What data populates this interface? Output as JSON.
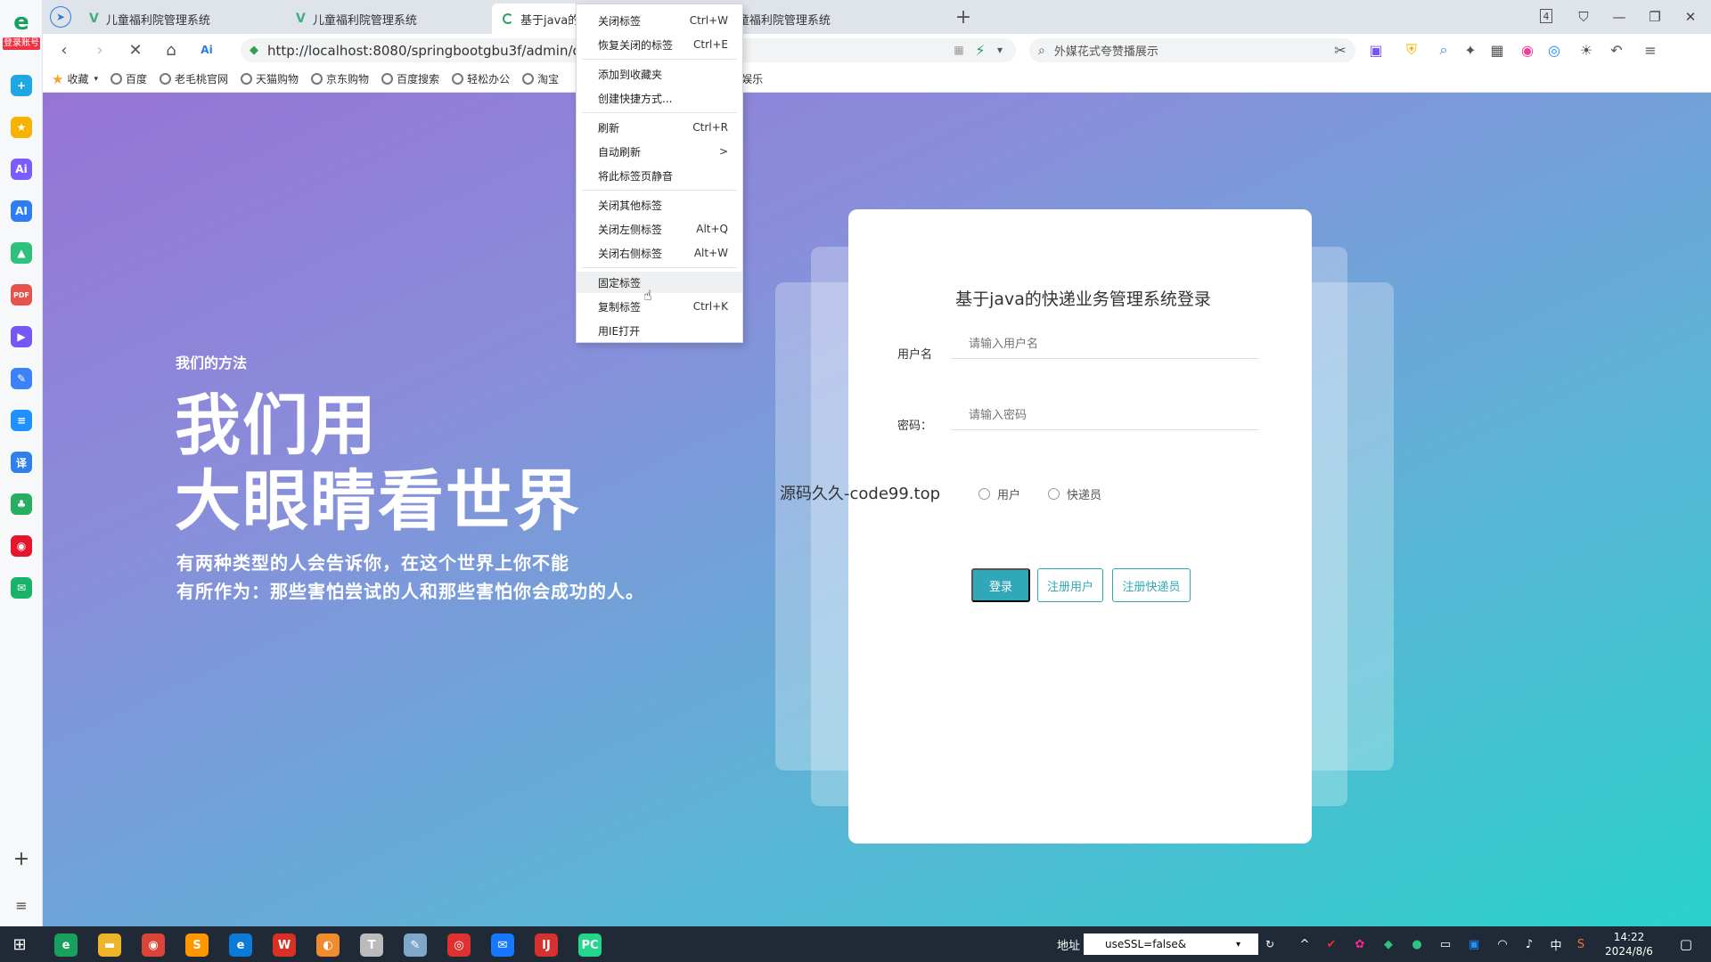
{
  "sidebar": {
    "logo_letter": "e",
    "logo_badge": "登录账号",
    "apps": [
      {
        "name": "app-add-icon",
        "glyph": "+",
        "color": "#1ea7e1"
      },
      {
        "name": "favorites-icon",
        "glyph": "★",
        "color": "#f6b400"
      },
      {
        "name": "ai-assistant-icon",
        "glyph": "Ai",
        "color": "#7b5cff"
      },
      {
        "name": "ai-write-icon",
        "glyph": "AI",
        "color": "#2f7df6"
      },
      {
        "name": "image-icon",
        "glyph": "▲",
        "color": "#2ec27e"
      },
      {
        "name": "pdf-icon",
        "glyph": "PDF",
        "color": "#e5534b"
      },
      {
        "name": "video-icon",
        "glyph": "▶",
        "color": "#7657f4"
      },
      {
        "name": "notes-icon",
        "glyph": "✎",
        "color": "#3b82f6"
      },
      {
        "name": "doc-icon",
        "glyph": "≡",
        "color": "#1e90ff"
      },
      {
        "name": "translate-icon",
        "glyph": "译",
        "color": "#2f80ed"
      },
      {
        "name": "game-icon",
        "glyph": "♣",
        "color": "#27ae60"
      },
      {
        "name": "weibo-icon",
        "glyph": "◉",
        "color": "#e6162d"
      },
      {
        "name": "mail-icon",
        "glyph": "✉",
        "color": "#19b26b"
      }
    ],
    "add_glyph": "+",
    "list_glyph": "≡"
  },
  "tabs": [
    {
      "title": "儿童福利院管理系统",
      "icon": "V"
    },
    {
      "title": "儿童福利院管理系统",
      "icon": "V"
    },
    {
      "title": "基于java的快",
      "icon": "spinner"
    },
    {
      "title": "儿童福利院管理系统",
      "icon": "V"
    }
  ],
  "tab_count": "4",
  "address": {
    "url": "http://localhost:8080/springbootgbu3f/admin/dist/",
    "search_placeholder": "外媒花式夸赞播展示"
  },
  "bookmarks": [
    {
      "label": "收藏",
      "icon": "star-icon"
    },
    {
      "label": "百度",
      "icon": "baidu-icon"
    },
    {
      "label": "老毛桃官网",
      "icon": "globe-icon"
    },
    {
      "label": "天猫购物",
      "icon": "globe-icon"
    },
    {
      "label": "京东购物",
      "icon": "globe-icon"
    },
    {
      "label": "百度搜索",
      "icon": "globe-icon"
    },
    {
      "label": "轻松办公",
      "icon": "globe-icon"
    },
    {
      "label": "淘宝",
      "icon": "globe-icon"
    },
    {
      "label": "游戏娱乐",
      "icon": "globe-icon"
    }
  ],
  "hero": {
    "small": "我们的方法",
    "big1": "我们用",
    "big2": "大眼睛看世界",
    "p1": "有两种类型的人会告诉你，在这个世界上你不能",
    "p2": "有所作为：那些害怕尝试的人和那些害怕你会成功的人。"
  },
  "login": {
    "title": "基于java的快递业务管理系统登录",
    "username_label": "用户名",
    "username_placeholder": "请输入用户名",
    "password_label": "密码：",
    "password_placeholder": "请输入密码",
    "watermark": "源码久久-code99.top",
    "roles": [
      "用户",
      "快递员"
    ],
    "login_button": "登录",
    "register_user_button": "注册用户",
    "register_courier_button": "注册快递员"
  },
  "context_menu": {
    "groups": [
      [
        {
          "label": "关闭标签",
          "shortcut": "Ctrl+W"
        },
        {
          "label": "恢复关闭的标签",
          "shortcut": "Ctrl+E"
        }
      ],
      [
        {
          "label": "添加到收藏夹",
          "shortcut": ""
        },
        {
          "label": "创建快捷方式...",
          "shortcut": ""
        }
      ],
      [
        {
          "label": "刷新",
          "shortcut": "Ctrl+R"
        },
        {
          "label": "自动刷新",
          "shortcut": ">"
        },
        {
          "label": "将此标签页静音",
          "shortcut": ""
        }
      ],
      [
        {
          "label": "关闭其他标签",
          "shortcut": ""
        },
        {
          "label": "关闭左侧标签",
          "shortcut": "Alt+Q"
        },
        {
          "label": "关闭右侧标签",
          "shortcut": "Alt+W"
        }
      ],
      [
        {
          "label": "固定标签",
          "shortcut": ""
        },
        {
          "label": "复制标签",
          "shortcut": "Ctrl+K"
        },
        {
          "label": "用IE打开",
          "shortcut": ""
        }
      ]
    ],
    "hovered": "固定标签"
  },
  "taskbar": {
    "address_label": "地址",
    "address_value": "useSSL=false&",
    "time": "14:22",
    "date": "2024/8/6",
    "ime": "中",
    "apps": [
      {
        "name": "taskbar-browser-360",
        "glyph": "e",
        "color": "#18a05e"
      },
      {
        "name": "taskbar-file-explorer",
        "glyph": "▬",
        "color": "#f0b429"
      },
      {
        "name": "taskbar-chrome",
        "glyph": "◉",
        "color": "#db4437"
      },
      {
        "name": "taskbar-sublime",
        "glyph": "S",
        "color": "#ff9800"
      },
      {
        "name": "taskbar-edge",
        "glyph": "e",
        "color": "#0a7bd6"
      },
      {
        "name": "taskbar-wps",
        "glyph": "W",
        "color": "#d93025"
      },
      {
        "name": "taskbar-game",
        "glyph": "◐",
        "color": "#f08c2e"
      },
      {
        "name": "taskbar-typora",
        "glyph": "T",
        "color": "#bbbbbb"
      },
      {
        "name": "taskbar-notes",
        "glyph": "✎",
        "color": "#7fa7c9"
      },
      {
        "name": "taskbar-netease",
        "glyph": "◎",
        "color": "#e03131"
      },
      {
        "name": "taskbar-qq-mail",
        "glyph": "✉",
        "color": "#1677ff"
      },
      {
        "name": "taskbar-intellij",
        "glyph": "IJ",
        "color": "#d6302f"
      },
      {
        "name": "taskbar-pycharm",
        "glyph": "PC",
        "color": "#21d789"
      }
    ]
  },
  "colors": {
    "primary": "#31a8b8",
    "brand": "#18a05e"
  }
}
